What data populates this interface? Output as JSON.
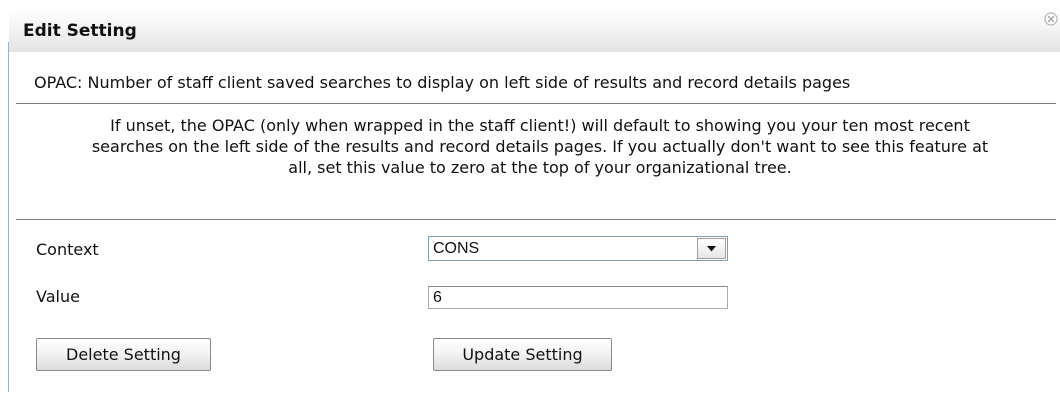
{
  "dialog": {
    "title": "Edit Setting",
    "close_icon": "close-icon"
  },
  "setting": {
    "name": "OPAC: Number of staff client saved searches to display on left side of results and record details pages",
    "description": "If unset, the OPAC (only when wrapped in the staff client!) will default to showing you your ten most recent searches on the left side of the results and record details pages. If you actually don't want to see this feature at all, set this value to zero at the top of your organizational tree."
  },
  "form": {
    "context_label": "Context",
    "context_value": "CONS",
    "value_label": "Value",
    "value_input": "6"
  },
  "buttons": {
    "delete_label": "Delete Setting",
    "update_label": "Update Setting"
  }
}
